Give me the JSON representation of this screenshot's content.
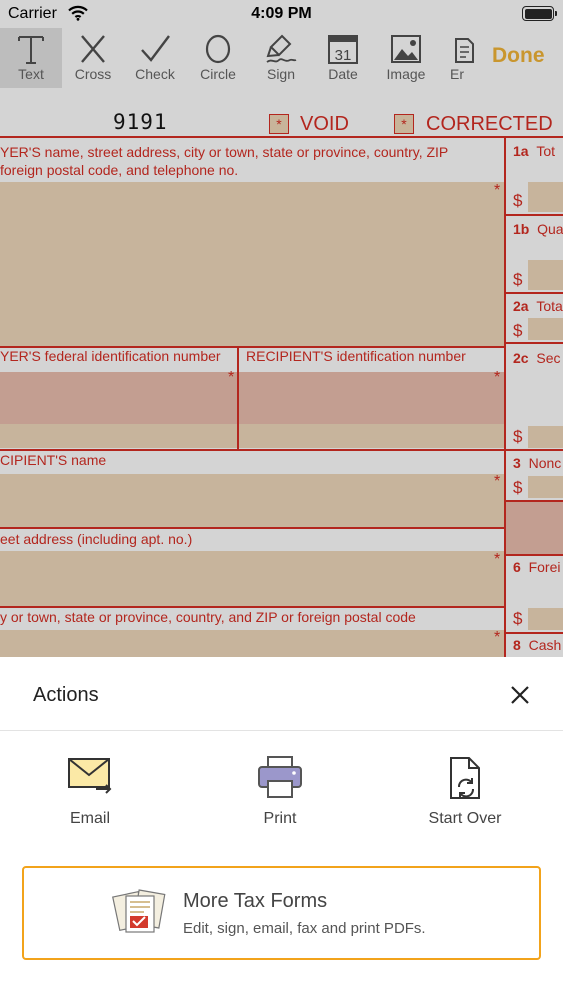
{
  "status_bar": {
    "carrier": "Carrier",
    "time": "4:09 PM"
  },
  "toolbar": {
    "tools": [
      {
        "label": "Text",
        "icon": "text-icon",
        "active": true
      },
      {
        "label": "Cross",
        "icon": "cross-icon"
      },
      {
        "label": "Check",
        "icon": "check-icon"
      },
      {
        "label": "Circle",
        "icon": "circle-icon"
      },
      {
        "label": "Sign",
        "icon": "sign-icon"
      },
      {
        "label": "Date",
        "icon": "calendar-icon",
        "icon_text": "31"
      },
      {
        "label": "Image",
        "icon": "image-icon"
      },
      {
        "label": "Er",
        "icon": "eraser-icon"
      }
    ],
    "done_label": "Done",
    "done_color": "#c9962e"
  },
  "form": {
    "code": "9191",
    "void_label": "VOID",
    "corrected_label": "CORRECTED",
    "checkbox_mark": "*",
    "payer_line1": "YER'S name, street address, city or town, state or province, country, ZIP",
    "payer_line2": "foreign postal code, and telephone no.",
    "payer_tin": "YER'S federal identification number",
    "recipient_tin": "RECIPIENT'S identification number",
    "recipient_name": "CIPIENT'S name",
    "street_address": "eet address (including apt. no.)",
    "city_line": "y or town, state or province, country, and ZIP or foreign postal code",
    "boxes": [
      {
        "num": "1a",
        "text": "Tot"
      },
      {
        "num": "1b",
        "text": "Qua"
      },
      {
        "num": "2a",
        "text": "Tota"
      },
      {
        "num": "2c",
        "text": "Sec"
      },
      {
        "num": "3",
        "text": "Nonc"
      },
      {
        "num": "6",
        "text": "Forei"
      },
      {
        "num": "8",
        "text": "Cash"
      }
    ],
    "dollar": "$",
    "required_mark": "*",
    "field_color": "#c7b49c",
    "label_color": "#b3261e"
  },
  "actions_sheet": {
    "title": "Actions",
    "items": [
      {
        "label": "Email",
        "icon": "email-icon"
      },
      {
        "label": "Print",
        "icon": "print-icon"
      },
      {
        "label": "Start Over",
        "icon": "start-over-icon"
      }
    ],
    "promo": {
      "title": "More Tax Forms",
      "subtitle": "Edit, sign, email, fax and print PDFs.",
      "icon": "tax-forms-icon",
      "border_color": "#f2a31b"
    }
  }
}
